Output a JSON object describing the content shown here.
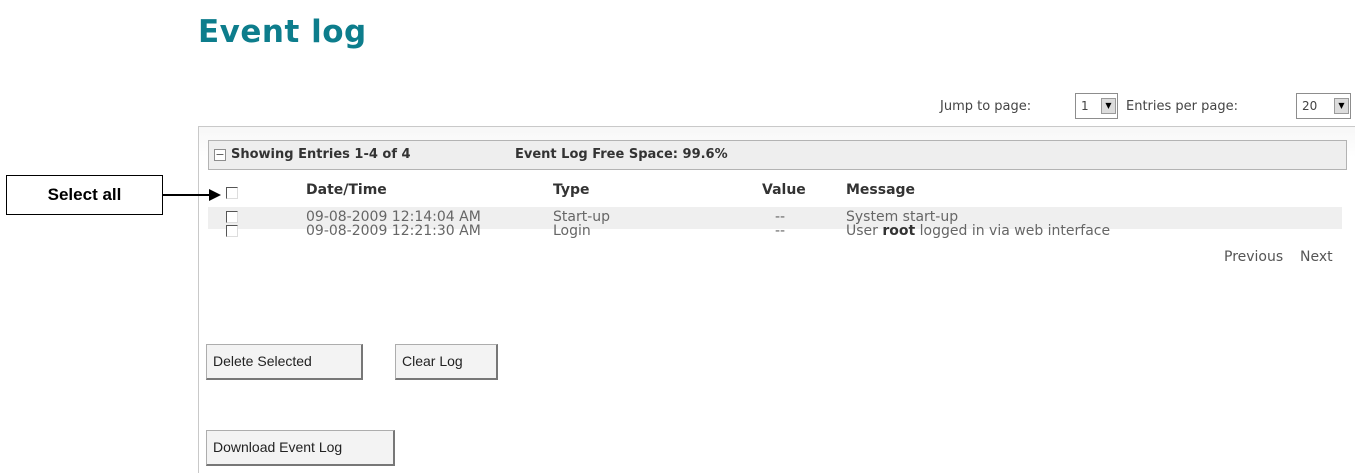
{
  "page": {
    "title": "Event log"
  },
  "pager": {
    "jump_label": "Jump to page:",
    "jump_value": "1",
    "entries_label": "Entries per page:",
    "entries_value": "20"
  },
  "summary": {
    "entries_text": "Showing Entries 1-4 of 4",
    "free_space_text": "Event Log Free Space: 99.6%"
  },
  "table": {
    "columns": [
      "Date/Time",
      "Type",
      "Value",
      "Message"
    ],
    "rows": [
      {
        "datetime": "09-08-2009 12:14:04 AM",
        "type": "Start-up",
        "value": "--",
        "message": "System start-up"
      },
      {
        "datetime": "09-08-2009 12:21:30 AM",
        "type": "Login",
        "value": "--",
        "message_pre": "User ",
        "message_bold": "root",
        "message_post": " logged in via web interface"
      }
    ]
  },
  "nav": {
    "previous": "Previous",
    "next": "Next"
  },
  "buttons": {
    "delete_selected": "Delete Selected",
    "clear_log": "Clear Log",
    "download": "Download Event Log"
  },
  "callout": {
    "label": "Select all"
  },
  "icons": {
    "dropdown": "dropdown-arrow-icon",
    "collapse": "collapse-toggle-icon"
  },
  "colors": {
    "title": "#0d7d8c"
  }
}
